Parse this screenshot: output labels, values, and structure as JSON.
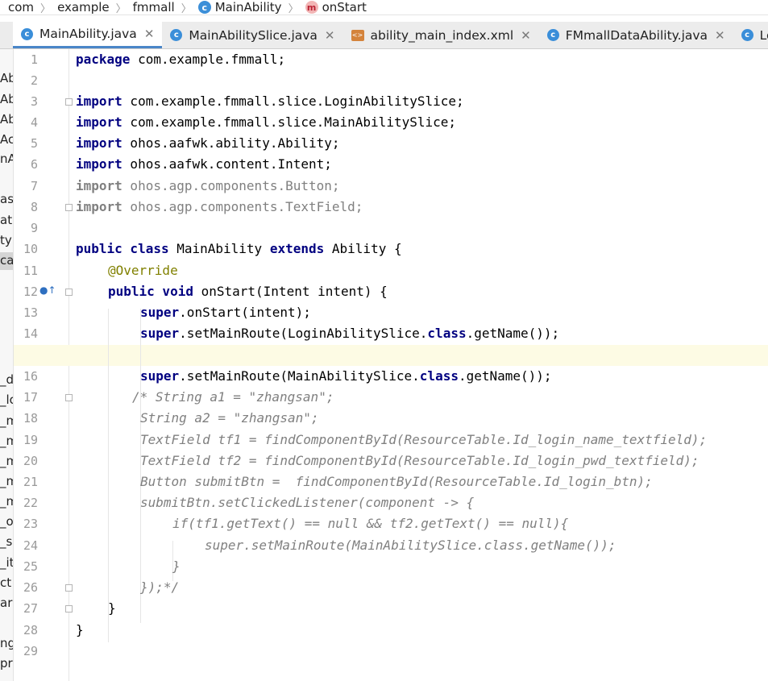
{
  "breadcrumb": [
    {
      "label": "com",
      "icon": ""
    },
    {
      "label": "example",
      "icon": ""
    },
    {
      "label": "fmmall",
      "icon": ""
    },
    {
      "label": "MainAbility",
      "icon": "class-icon"
    },
    {
      "label": "onStart",
      "icon": "method-icon"
    }
  ],
  "tabs": [
    {
      "label": "MainAbility.java",
      "icon": "java-class-icon",
      "active": true
    },
    {
      "label": "MainAbilitySlice.java",
      "icon": "java-class-icon",
      "active": false
    },
    {
      "label": "ability_main_index.xml",
      "icon": "xml-file-icon",
      "active": false
    },
    {
      "label": "FMmallDataAbility.java",
      "icon": "java-class-icon",
      "active": false
    },
    {
      "label": "LoginA",
      "icon": "java-class-icon",
      "active": false
    }
  ],
  "left_panel_fragments": [
    "Ab",
    "Ab",
    "Abi",
    "Ac",
    "nA",
    "ase",
    "ata",
    "ty",
    "cat",
    "_d",
    "_lo",
    "_m",
    "_m",
    "_m",
    "_m",
    "_m",
    "_o",
    "_s",
    "_ite",
    "ct",
    "ar",
    "ng",
    "pr"
  ],
  "line_numbers": [
    "1",
    "2",
    "3",
    "4",
    "5",
    "6",
    "7",
    "8",
    "9",
    "10",
    "11",
    "12",
    "13",
    "14",
    "15",
    "16",
    "17",
    "18",
    "19",
    "20",
    "21",
    "22",
    "23",
    "24",
    "25",
    "26",
    "27",
    "28",
    "29"
  ],
  "code": {
    "l1_kw": "package",
    "l1_rest": " com.example.fmmall;",
    "l3_kw": "import",
    "l3_rest": " com.example.fmmall.slice.LoginAbilitySlice;",
    "l4_kw": "import",
    "l4_rest": " com.example.fmmall.slice.MainAbilitySlice;",
    "l5_kw": "import",
    "l5_rest": " ohos.aafwk.ability.Ability;",
    "l6_kw": "import",
    "l6_rest": " ohos.aafwk.content.Intent;",
    "l7_kw": "import",
    "l7_rest": " ohos.agp.components.Button;",
    "l8_kw": "import",
    "l8_rest": " ohos.agp.components.TextField;",
    "l10_kw1": "public class",
    "l10_mid": " MainAbility ",
    "l10_kw2": "extends",
    "l10_rest": " Ability {",
    "l11": "@Override",
    "l12_kw": "public void",
    "l12_rest": " onStart(Intent intent) {",
    "l13_kw": "super",
    "l13_rest": ".onStart(intent);",
    "l14_kw": "super",
    "l14_mid": ".setMainRoute(LoginAbilitySlice.",
    "l14_kw2": "class",
    "l14_rest": ".getName());",
    "l16_kw": "super",
    "l16_mid": ".setMainRoute(MainAbilitySlice.",
    "l16_kw2": "class",
    "l16_rest": ".getName());",
    "l17": "/* String a1 = \"zhangsan\";",
    "l18": "String a2 = \"zhangsan\";",
    "l19": "TextField tf1 = findComponentById(ResourceTable.Id_login_name_textfield);",
    "l20": "TextField tf2 = findComponentById(ResourceTable.Id_login_pwd_textfield);",
    "l21": "Button submitBtn =  findComponentById(ResourceTable.Id_login_btn);",
    "l22": "submitBtn.setClickedListener(component -> {",
    "l23": "if(tf1.getText() == null && tf2.getText() == null){",
    "l24": "super.setMainRoute(MainAbilitySlice.class.getName());",
    "l25": "}",
    "l26": "});*/",
    "l27": "}",
    "l28": "}"
  },
  "colors": {
    "keyword": "#000080",
    "annotation": "#808000",
    "comment": "#808080",
    "current_line": "#fdfbe4",
    "tab_underline": "#4a86c8"
  }
}
